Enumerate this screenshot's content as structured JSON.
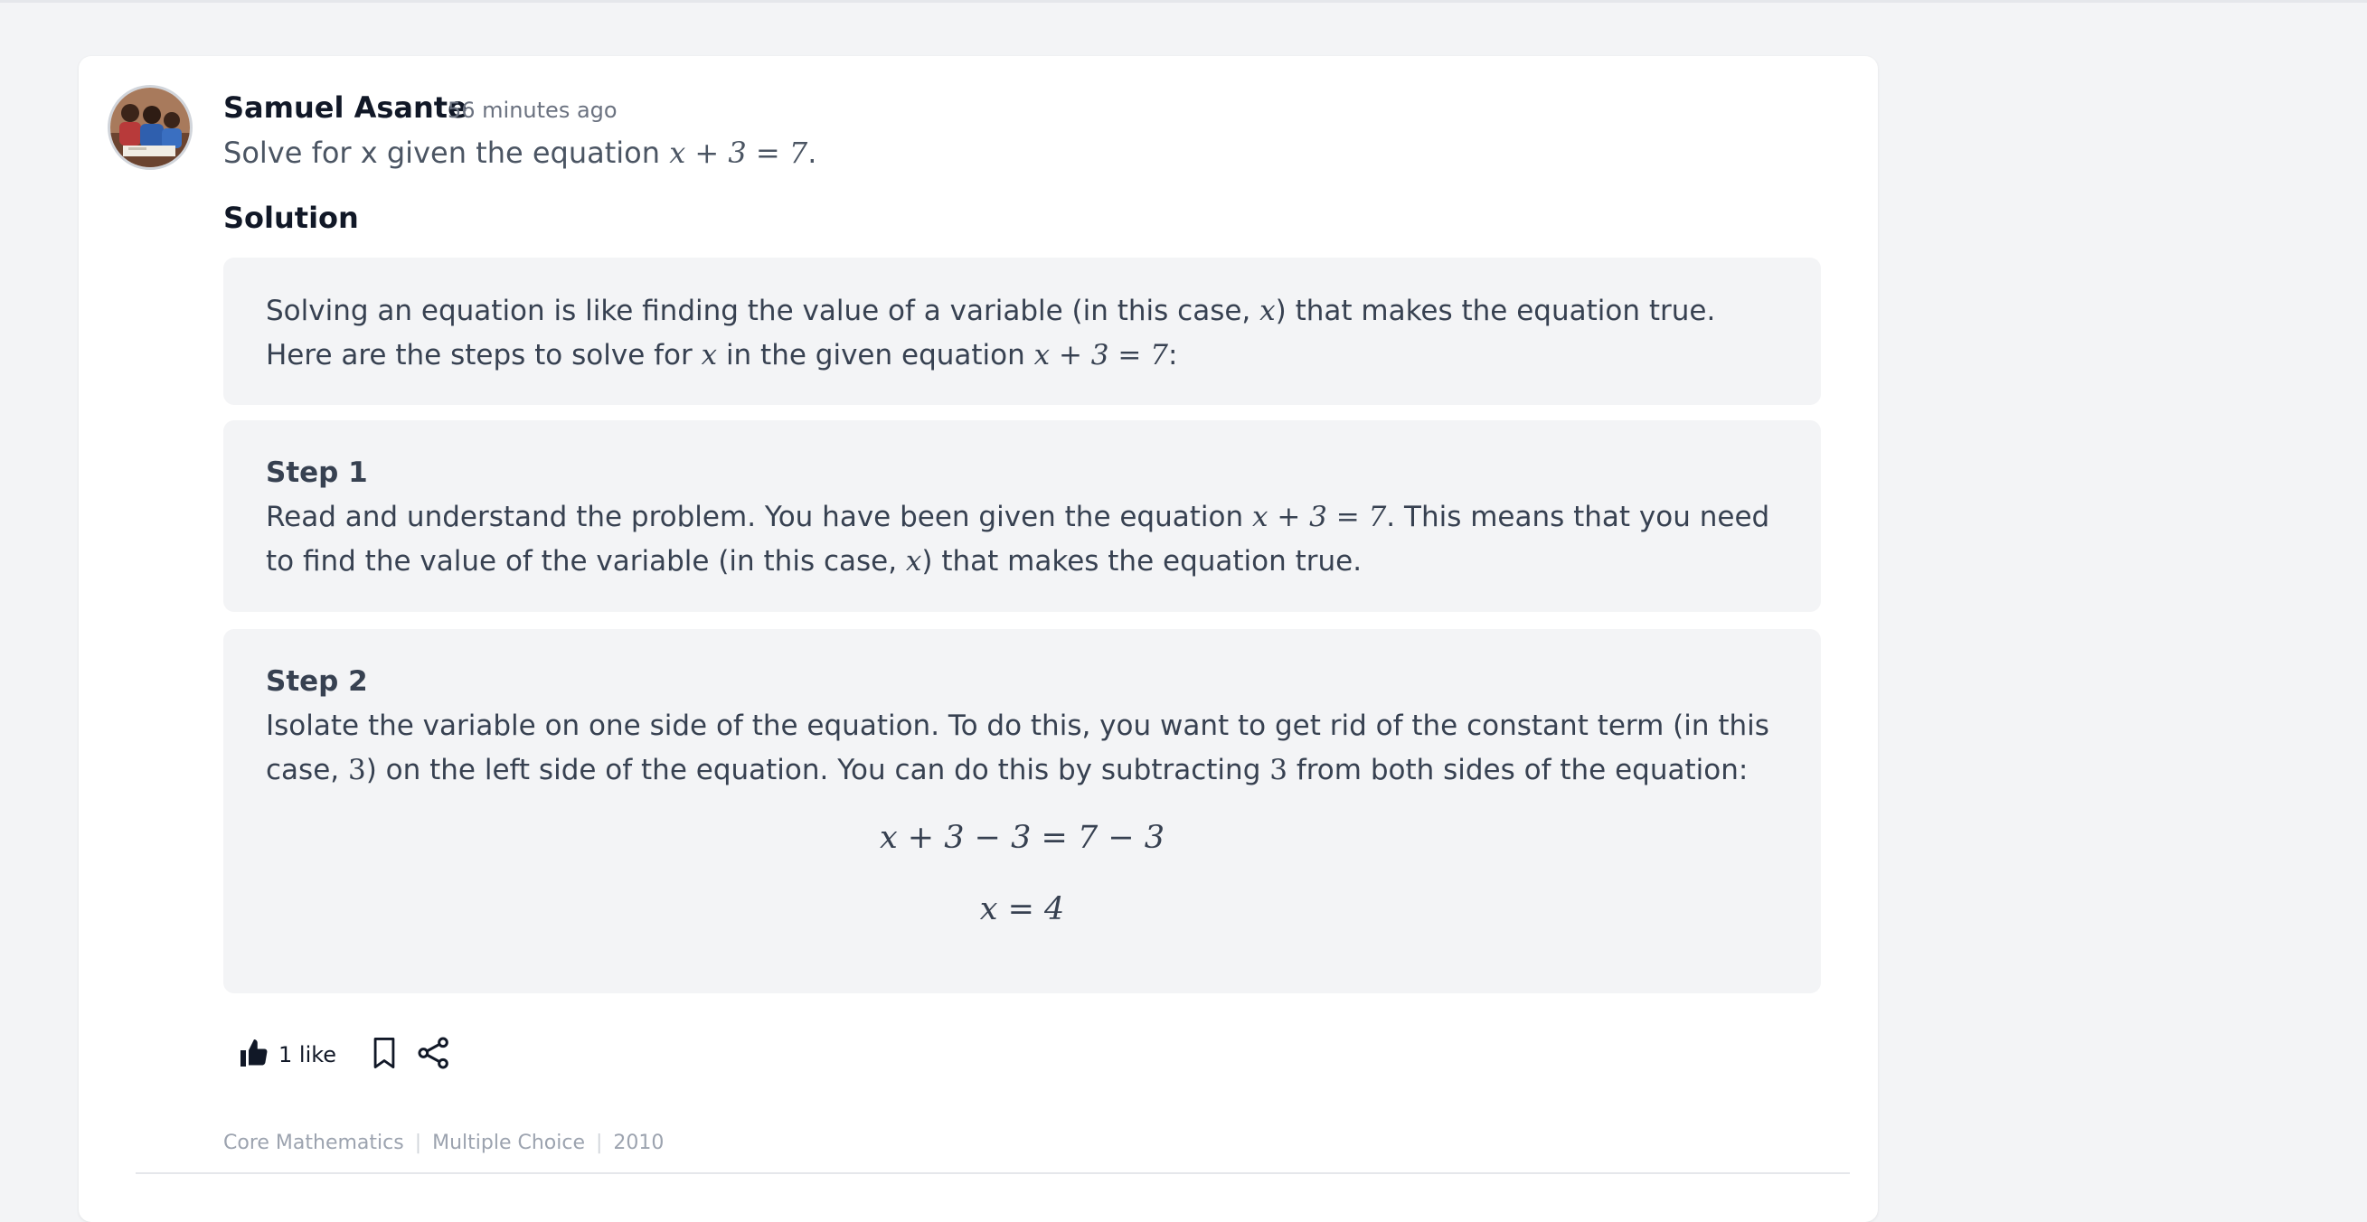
{
  "post": {
    "author": "Samuel Asante",
    "timestamp": "56 minutes ago",
    "question_prefix": "Solve for x given the equation ",
    "question_eq": "x + 3 = 7",
    "question_suffix": "."
  },
  "solution": {
    "heading": "Solution",
    "intro": {
      "text_a": "Solving an equation is like finding the value of a variable (in this case, ",
      "var": "x",
      "text_b": ") that makes the equation true. Here are the steps to solve for ",
      "text_c": " in the given equation ",
      "eq": "x + 3 = 7",
      "text_d": ":"
    },
    "step1": {
      "title": "Step 1",
      "text_a": "Read and understand the problem. You have been given the equation ",
      "eq": "x + 3 = 7",
      "text_b": ". This means that you need to find the value of the variable (in this case, ",
      "var": "x",
      "text_c": ") that makes the equation true."
    },
    "step2": {
      "title": "Step 2",
      "text_a": "Isolate the variable on one side of the equation. To do this, you want to get rid of the constant term (in this case, ",
      "const": "3",
      "text_b": ") on the left side of the equation. You can do this by subtracting ",
      "text_c": " from both sides of the equation:",
      "display_eq1": "x + 3 − 3 = 7 − 3",
      "display_eq2": "x = 4"
    }
  },
  "actions": {
    "like_count": "1 like",
    "like_icon": "thumbs-up-icon",
    "bookmark_icon": "bookmark-icon",
    "share_icon": "share-icon"
  },
  "tags": [
    "Core Mathematics",
    "Multiple Choice",
    "2010"
  ],
  "tag_separator": "|",
  "colors": {
    "background": "#f3f4f6",
    "card": "#ffffff",
    "text": "#374151",
    "heading": "#111827",
    "muted": "#9ca3af"
  }
}
